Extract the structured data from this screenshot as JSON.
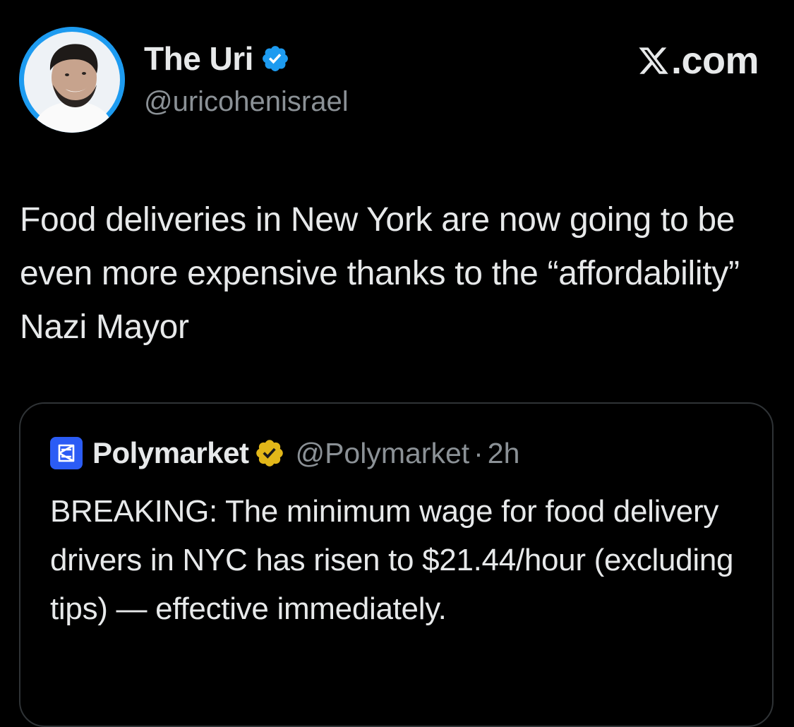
{
  "author": {
    "display_name": "The Uri",
    "handle": "@uricohenisrael",
    "avatar": "avatar-photo",
    "verified_icon": "verified-badge-blue-icon"
  },
  "brand": {
    "icon": "x-logo-icon",
    "label": ".com"
  },
  "tweet": {
    "text": "Food deliveries in New York are now going to be even more expensive thanks to the “affordability” Nazi Mayor"
  },
  "quote": {
    "logo": "polymarket-logo-icon",
    "display_name": "Polymarket",
    "verified_icon": "verified-badge-gold-icon",
    "handle": "@Polymarket",
    "separator": "·",
    "time": "2h",
    "text": "BREAKING: The minimum wage for food delivery drivers in NYC has risen to $21.44/hour (excluding tips) — effective immediately."
  },
  "colors": {
    "background": "#000000",
    "text_primary": "#e7e9ea",
    "text_secondary": "#8b9196",
    "border": "#2f3336",
    "verified_blue": "#1d9bf0",
    "verified_gold": "#e2b719",
    "polymarket_blue": "#2b5cf5"
  }
}
